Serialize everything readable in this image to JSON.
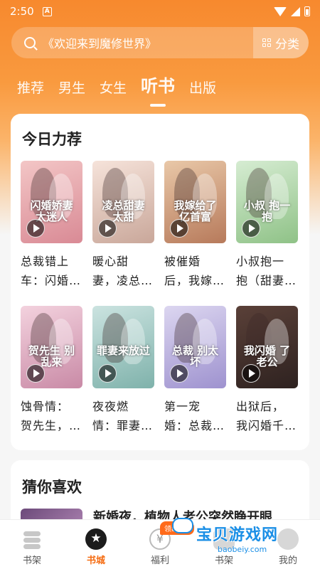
{
  "status": {
    "time": "2:50",
    "notif": "A"
  },
  "search": {
    "placeholder": "《欢迎来到魔修世界》",
    "category_label": "分类"
  },
  "tabs": [
    {
      "label": "推荐"
    },
    {
      "label": "男生"
    },
    {
      "label": "女生"
    },
    {
      "label": "听书"
    },
    {
      "label": "出版"
    }
  ],
  "active_tab": "听书",
  "recommend": {
    "title": "今日力荐",
    "books": [
      {
        "name": "总裁错上\n车：闪婚…",
        "cover_text": "闪婚娇妻\n太迷人",
        "cover_colors": [
          "#f3c6c6",
          "#d98a95"
        ]
      },
      {
        "name": "暖心甜\n妻，凌总…",
        "cover_text": "凌总甜妻\n太甜",
        "cover_colors": [
          "#f6e3da",
          "#c9a79a"
        ]
      },
      {
        "name": "被催婚\n后，我嫁…",
        "cover_text": "我嫁给了\n亿首富",
        "cover_colors": [
          "#e9c8a8",
          "#b77a5b"
        ]
      },
      {
        "name": "小叔抱一\n抱（甜妻…",
        "cover_text": "小叔\n抱一抱",
        "cover_colors": [
          "#d6ecd2",
          "#8fc287"
        ]
      },
      {
        "name": "蚀骨情：\n贺先生，…",
        "cover_text": "贺先生\n别乱来",
        "cover_colors": [
          "#f3d2de",
          "#c98aa6"
        ]
      },
      {
        "name": "夜夜燃\n情：罪妻…",
        "cover_text": "罪妻来放过\n",
        "cover_colors": [
          "#cbe3e0",
          "#7fb2ab"
        ]
      },
      {
        "name": "第一宠\n婚：总裁…",
        "cover_text": "总裁\n别太坏",
        "cover_colors": [
          "#dcd6f0",
          "#9e92cf"
        ]
      },
      {
        "name": "出狱后，\n我闪婚千…",
        "cover_text": "我闪婚\n了老公",
        "cover_colors": [
          "#5a4038",
          "#2e2220"
        ]
      }
    ]
  },
  "guess": {
    "title": "猜你喜欢",
    "preview_text": "新婚夜，植物人老公突然睁开眼"
  },
  "nav": {
    "items": [
      {
        "label": "书架"
      },
      {
        "label": "书城"
      },
      {
        "label": "福利"
      },
      {
        "label": "书架"
      },
      {
        "label": "我的"
      }
    ],
    "active": "书城",
    "welfare_badge": "领8.0元"
  },
  "watermark": {
    "main": "宝贝游戏网",
    "sub": "baobeiy.com"
  },
  "colors": {
    "accent": "#f56b10",
    "header": "#f7892e"
  }
}
